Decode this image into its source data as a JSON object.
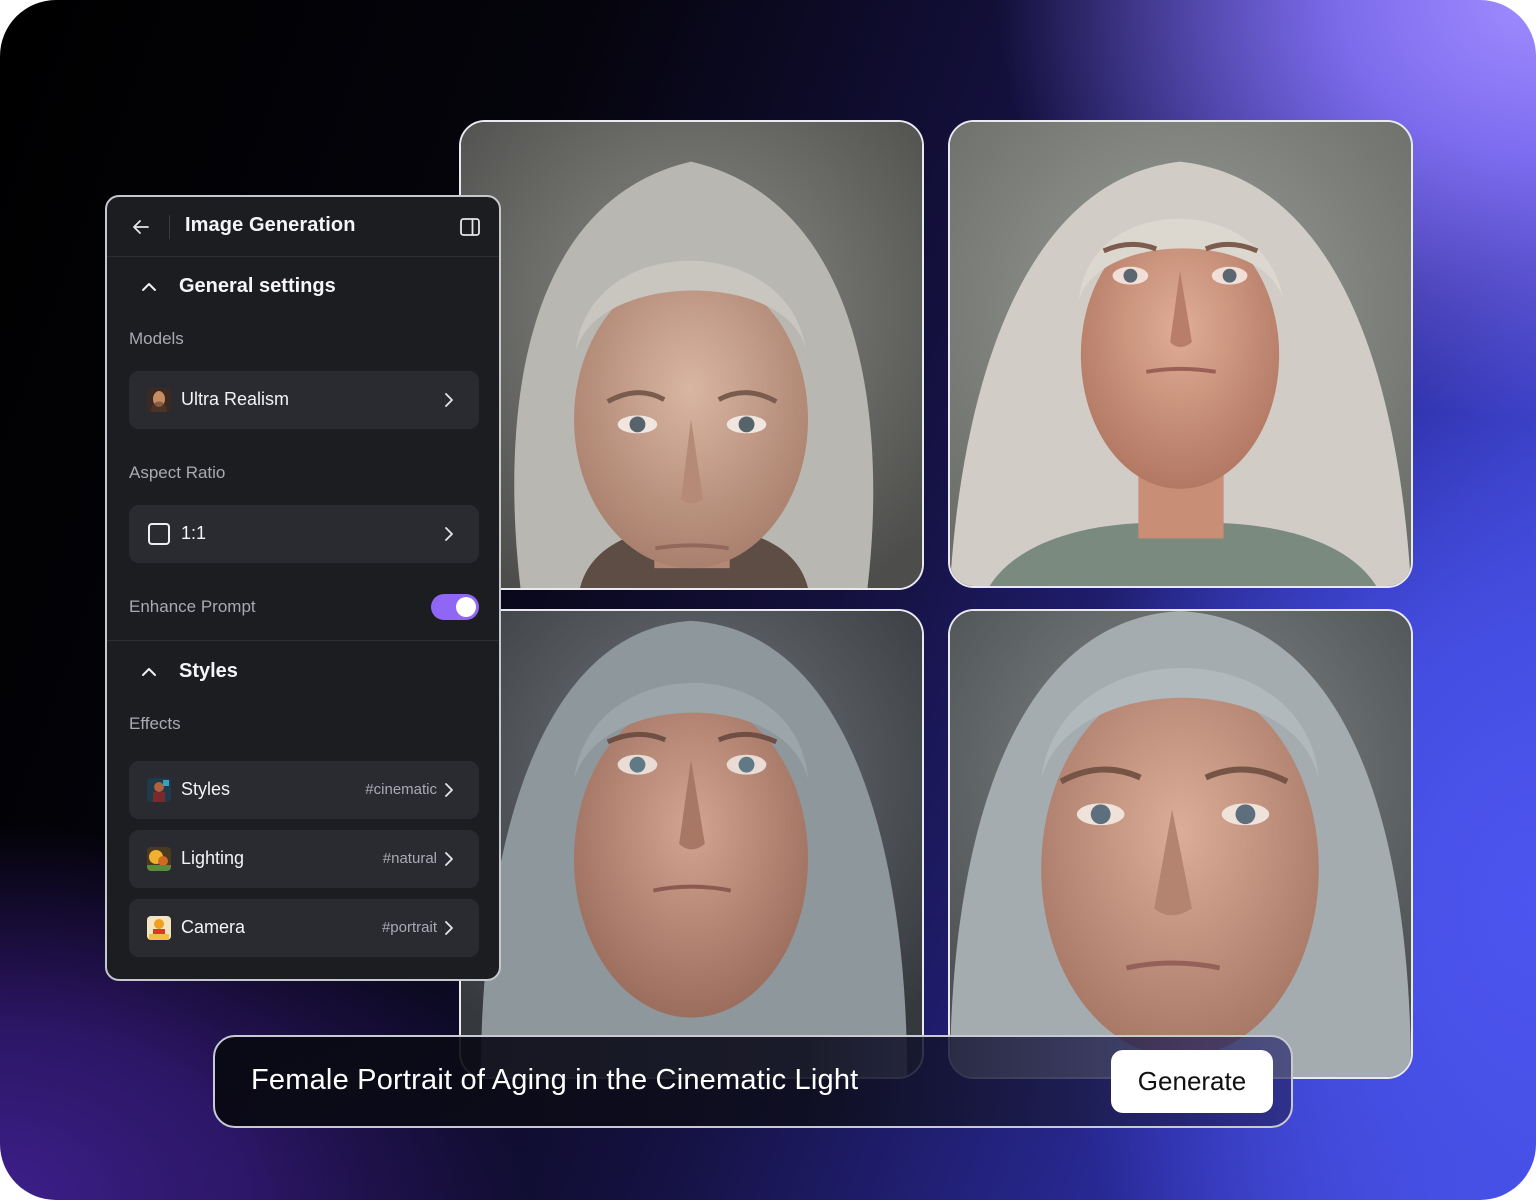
{
  "panel": {
    "title": "Image Generation",
    "general_settings": {
      "label": "General settings",
      "models_label": "Models",
      "model_value": "Ultra Realism",
      "aspect_ratio_label": "Aspect Ratio",
      "aspect_ratio_value": "1:1",
      "enhance_prompt_label": "Enhance Prompt",
      "enhance_prompt_on": true
    },
    "styles": {
      "label": "Styles",
      "effects_label": "Effects",
      "items": [
        {
          "label": "Styles",
          "tag": "#cinematic",
          "icon": "styles-thumb-icon"
        },
        {
          "label": "Lighting",
          "tag": "#natural",
          "icon": "lighting-thumb-icon"
        },
        {
          "label": "Camera",
          "tag": "#portrait",
          "icon": "camera-thumb-icon"
        }
      ]
    }
  },
  "prompt": {
    "text": "Female Portrait of Aging in the Cinematic Light",
    "generate_label": "Generate"
  },
  "colors": {
    "panel_bg": "#1c1d21",
    "row_bg": "#2a2b30",
    "toggle_on": "#9066f5",
    "accent_gradient_end": "#4e55ef"
  },
  "icons": [
    "back-arrow-icon",
    "sidebar-toggle-icon",
    "chevron-up-icon",
    "chevron-right-icon",
    "square-aspect-icon"
  ]
}
